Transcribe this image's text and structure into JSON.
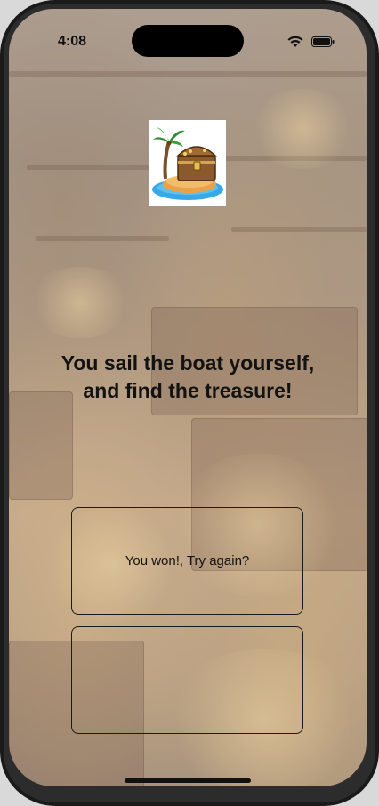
{
  "status_bar": {
    "time": "4:08",
    "wifi_icon": "wifi-icon",
    "battery_icon": "battery-icon"
  },
  "header": {
    "image_icon": "treasure-island-icon"
  },
  "story": {
    "text": "You sail the boat yourself, and find the treasure!"
  },
  "choices": [
    {
      "label": "You won!, Try again?"
    },
    {
      "label": ""
    }
  ],
  "colors": {
    "text": "#121212",
    "button_border": "#1a1a1a"
  }
}
